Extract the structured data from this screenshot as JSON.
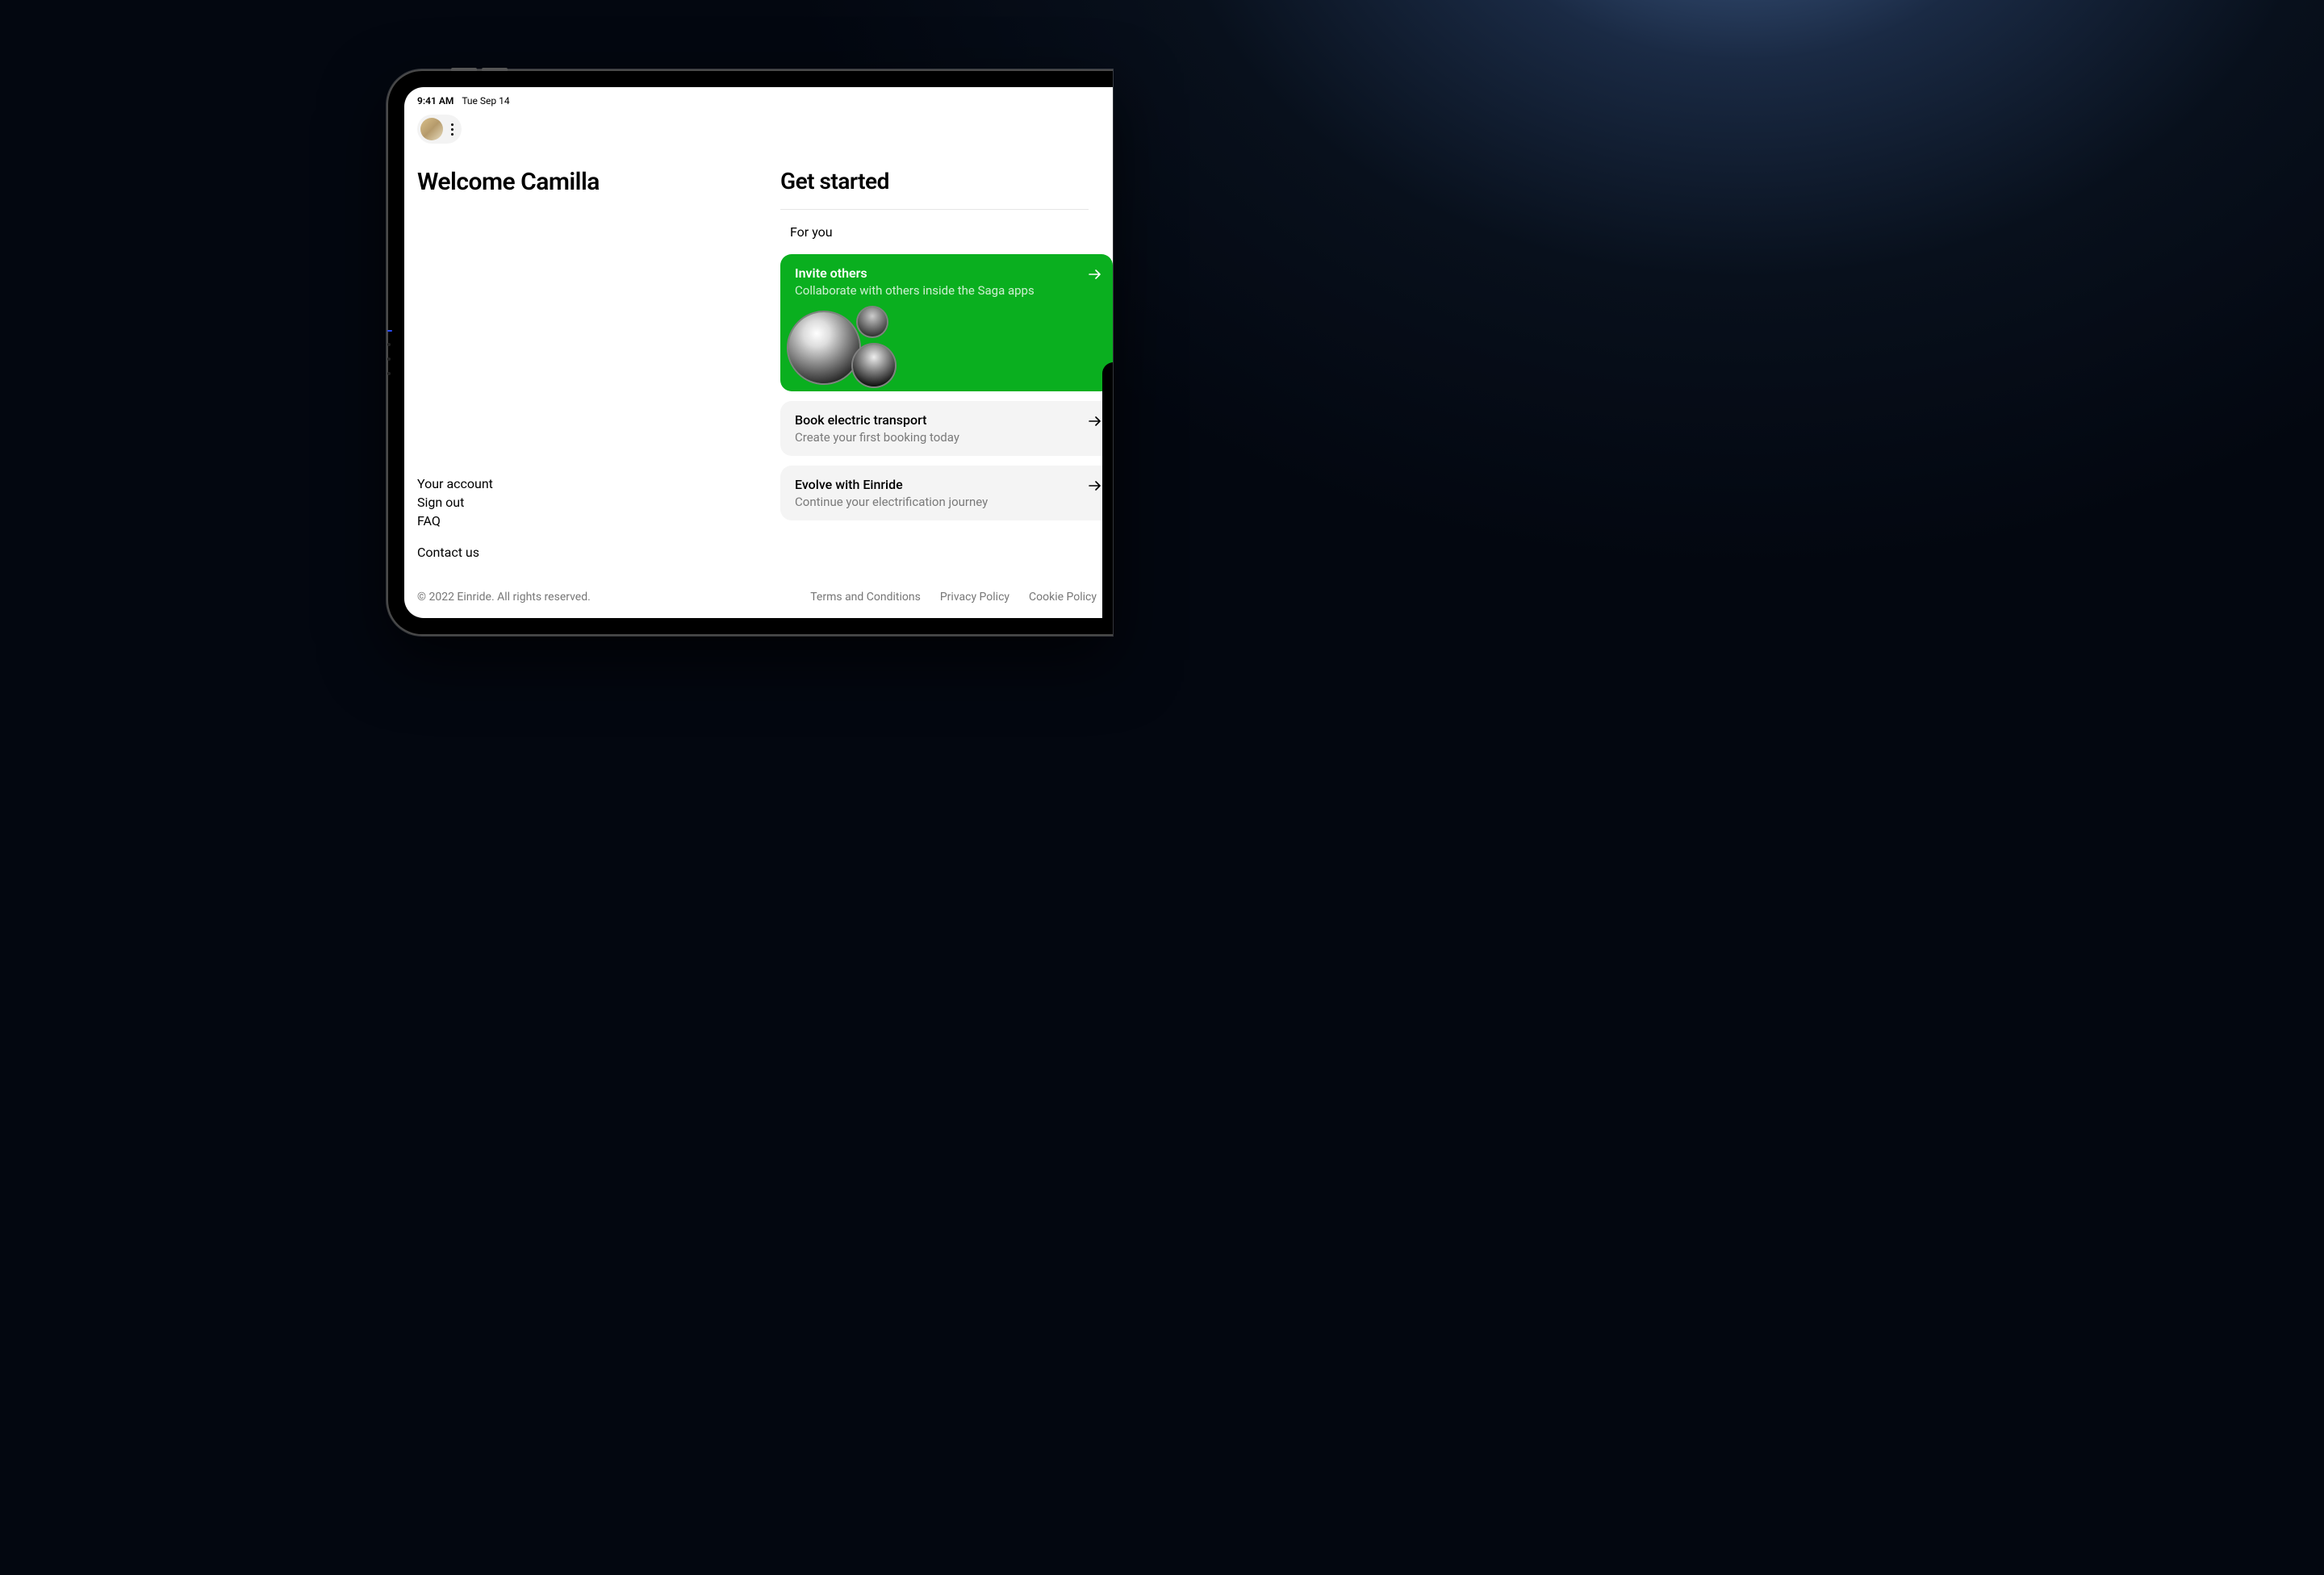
{
  "status_bar": {
    "time": "9:41 AM",
    "date": "Tue Sep 14"
  },
  "header": {
    "welcome_title": "Welcome Camilla"
  },
  "sidebar_links": {
    "your_account": "Your account",
    "sign_out": "Sign out",
    "faq": "FAQ",
    "contact_us": "Contact us"
  },
  "get_started": {
    "title": "Get started",
    "tab_for_you": "For you",
    "cards": [
      {
        "title": "Invite others",
        "subtitle": "Collaborate with others inside the Saga apps"
      },
      {
        "title": "Book electric transport",
        "subtitle": "Create your first booking today"
      },
      {
        "title": "Evolve with Einride",
        "subtitle": "Continue your electrification journey"
      }
    ]
  },
  "footer": {
    "copyright": "© 2022 Einride. All rights reserved.",
    "terms": "Terms and Conditions",
    "privacy": "Privacy Policy",
    "cookie": "Cookie Policy"
  }
}
